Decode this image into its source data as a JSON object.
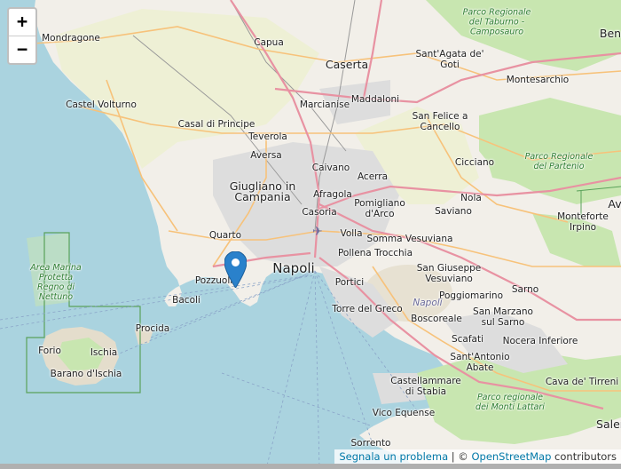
{
  "controls": {
    "zoom_in": "+",
    "zoom_out": "−"
  },
  "attribution": {
    "report": "Segnala un problema",
    "separator": " | © ",
    "osm": "OpenStreetMap",
    "suffix": " contributors"
  },
  "colors": {
    "sea": "#aad3df",
    "land": "#f2efe9",
    "park": "#c8e6b0",
    "farmland": "#eef0d5",
    "urban": "#dddddd",
    "major_road": "#e892a2",
    "secondary_road": "#f7c27a",
    "marker": "#2a81cb"
  },
  "places": [
    {
      "id": "mondragone",
      "name": "Mondragone",
      "cls": ""
    },
    {
      "id": "capua",
      "name": "Capua",
      "cls": ""
    },
    {
      "id": "caserta",
      "name": "Caserta",
      "cls": "big"
    },
    {
      "id": "santagata",
      "name": "Sant'Agata de' Goti",
      "cls": ""
    },
    {
      "id": "benevento",
      "name": "Ben",
      "cls": "big"
    },
    {
      "id": "castel-volturno",
      "name": "Castel Volturno",
      "cls": ""
    },
    {
      "id": "marcianise",
      "name": "Marcianise",
      "cls": ""
    },
    {
      "id": "maddaloni",
      "name": "Maddaloni",
      "cls": ""
    },
    {
      "id": "montesarchio",
      "name": "Montesarchio",
      "cls": ""
    },
    {
      "id": "casal-di-principe",
      "name": "Casal di Principe",
      "cls": ""
    },
    {
      "id": "san-felice",
      "name": "San Felice a Cancello",
      "cls": ""
    },
    {
      "id": "teverola",
      "name": "Teverola",
      "cls": ""
    },
    {
      "id": "aversa",
      "name": "Aversa",
      "cls": ""
    },
    {
      "id": "caivano",
      "name": "Caivano",
      "cls": ""
    },
    {
      "id": "cicciano",
      "name": "Cicciano",
      "cls": ""
    },
    {
      "id": "giugliano",
      "name": "Giugliano in Campania",
      "cls": "big"
    },
    {
      "id": "afragola",
      "name": "Afragola",
      "cls": ""
    },
    {
      "id": "acerra",
      "name": "Acerra",
      "cls": ""
    },
    {
      "id": "nola",
      "name": "Nola",
      "cls": ""
    },
    {
      "id": "casoria",
      "name": "Casoria",
      "cls": ""
    },
    {
      "id": "pomigliano",
      "name": "Pomigliano d'Arco",
      "cls": ""
    },
    {
      "id": "saviano",
      "name": "Saviano",
      "cls": ""
    },
    {
      "id": "avellino",
      "name": "Av",
      "cls": "big"
    },
    {
      "id": "monteforte",
      "name": "Monteforte Irpino",
      "cls": ""
    },
    {
      "id": "quarto",
      "name": "Quarto",
      "cls": ""
    },
    {
      "id": "volla",
      "name": "Volla",
      "cls": ""
    },
    {
      "id": "somma",
      "name": "Somma Vesuviana",
      "cls": ""
    },
    {
      "id": "napoli",
      "name": "Napoli",
      "cls": "city"
    },
    {
      "id": "pollena",
      "name": "Pollena Trocchia",
      "cls": ""
    },
    {
      "id": "pozzuoli",
      "name": "Pozzuoli",
      "cls": ""
    },
    {
      "id": "san-giuseppe",
      "name": "San Giuseppe Vesuviano",
      "cls": ""
    },
    {
      "id": "portici",
      "name": "Portici",
      "cls": ""
    },
    {
      "id": "sarno",
      "name": "Sarno",
      "cls": ""
    },
    {
      "id": "bacoli",
      "name": "Bacoli",
      "cls": ""
    },
    {
      "id": "poggiomarino",
      "name": "Poggiomarino",
      "cls": ""
    },
    {
      "id": "torre-del-greco",
      "name": "Torre del Greco",
      "cls": ""
    },
    {
      "id": "napoli-vesuvio",
      "name": "Napoli",
      "cls": "italic-gray"
    },
    {
      "id": "san-marzano",
      "name": "San Marzano sul Sarno",
      "cls": ""
    },
    {
      "id": "boscoreale",
      "name": "Boscoreale",
      "cls": ""
    },
    {
      "id": "procida",
      "name": "Procida",
      "cls": ""
    },
    {
      "id": "nocera",
      "name": "Nocera Inferiore",
      "cls": ""
    },
    {
      "id": "forio",
      "name": "Forio",
      "cls": ""
    },
    {
      "id": "ischia",
      "name": "Ischia",
      "cls": ""
    },
    {
      "id": "scafati",
      "name": "Scafati",
      "cls": ""
    },
    {
      "id": "barano",
      "name": "Barano d'Ischia",
      "cls": ""
    },
    {
      "id": "sant-antonio",
      "name": "Sant'Antonio Abate",
      "cls": ""
    },
    {
      "id": "cava",
      "name": "Cava de' Tirreni",
      "cls": ""
    },
    {
      "id": "castellammare",
      "name": "Castellammare di Stabia",
      "cls": ""
    },
    {
      "id": "vico",
      "name": "Vico Equense",
      "cls": ""
    },
    {
      "id": "salerno",
      "name": "Saler",
      "cls": "big"
    },
    {
      "id": "sorrento",
      "name": "Sorrento",
      "cls": ""
    }
  ],
  "parks": [
    {
      "id": "taburno",
      "name": "Parco Regionale del Taburno - Camposauro"
    },
    {
      "id": "partenio",
      "name": "Parco Regionale del Partenio"
    },
    {
      "id": "regno-nettuno",
      "name": "Area Marina Protetta Regno di Nettuno"
    },
    {
      "id": "monti-lattari",
      "name": "Parco regionale dei Monti Lattari"
    }
  ]
}
